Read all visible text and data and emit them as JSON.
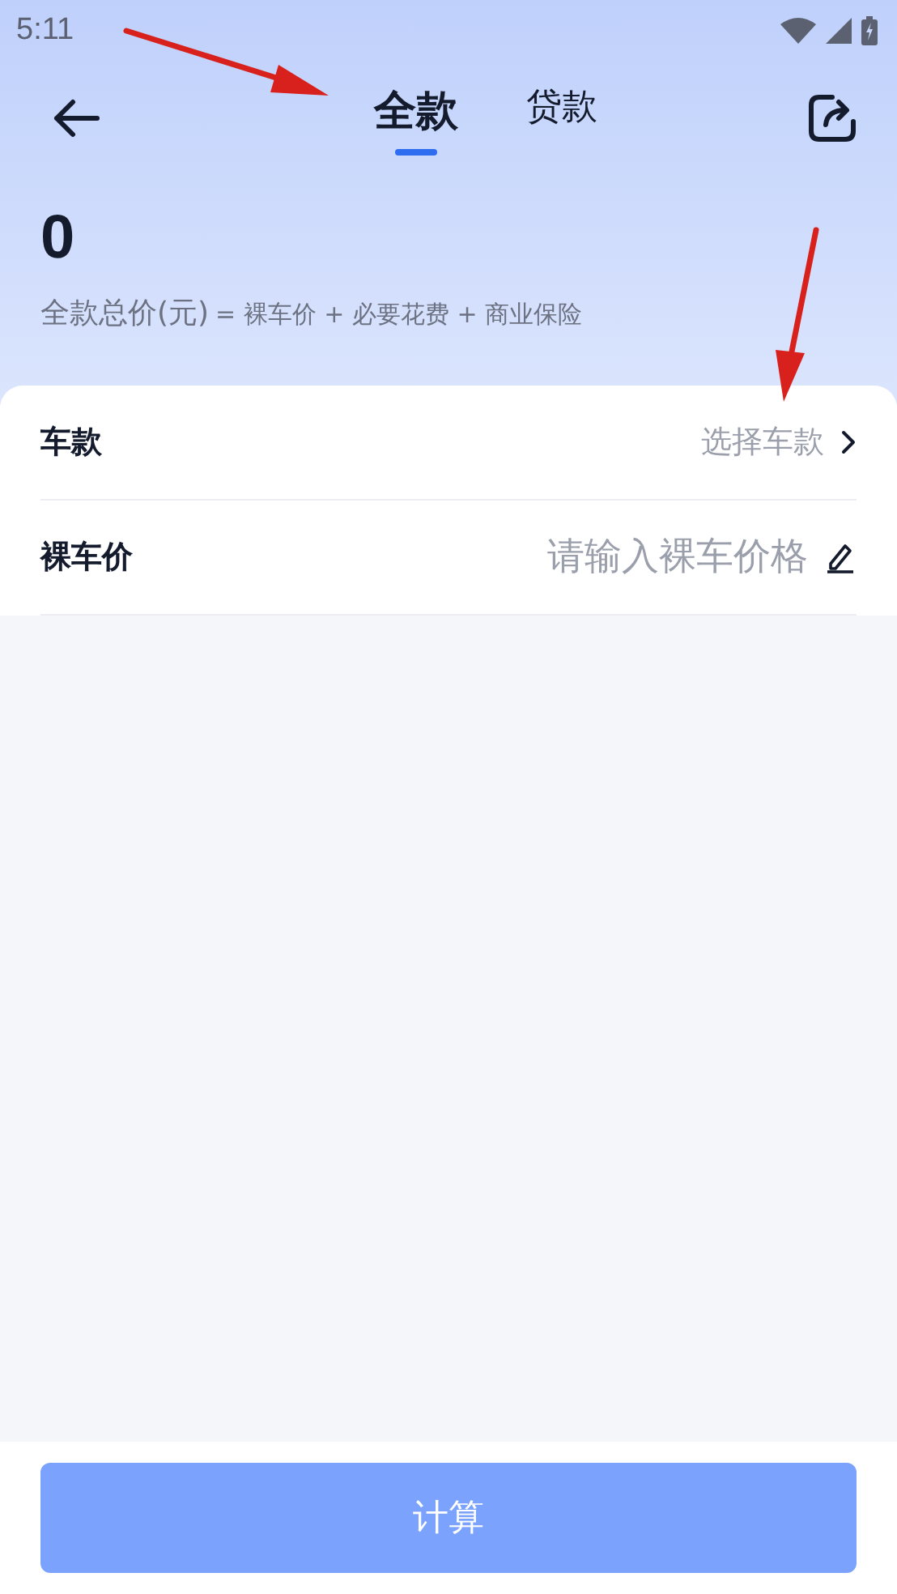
{
  "status_bar": {
    "time": "5:11"
  },
  "tabs": [
    {
      "label": "全款",
      "selected": true
    },
    {
      "label": "贷款",
      "selected": false
    }
  ],
  "summary": {
    "amount": "0",
    "label": "全款总价(元)",
    "expression": "= 裸车价 + 必要花费 + 商业保险"
  },
  "form": [
    {
      "kind": "select",
      "label": "车款",
      "placeholder": "选择车款"
    },
    {
      "kind": "input",
      "label": "裸车价",
      "placeholder": "请输入裸车价格"
    }
  ],
  "calculate_button": {
    "label": "计算",
    "disabled": true
  }
}
